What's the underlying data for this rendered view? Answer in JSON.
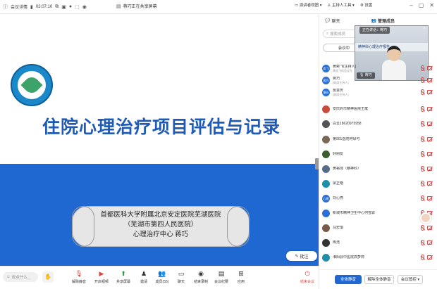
{
  "topbar": {
    "meeting_details": "会议详情",
    "timer": "02:07:10",
    "sharing_status": "蒋巧正在共享屏幕",
    "speaker_view": "演讲者视图",
    "host_tools": "主持人工具",
    "settings": "设置"
  },
  "slide": {
    "title": "住院心理治疗项目评估与记录",
    "caption_line1": "首都医科大学附属北京安定医院芜湖医院",
    "caption_line2": "（芜湖市第四人民医院）",
    "caption_line3": "心理治疗中心    蒋巧",
    "annotate_label": "批注"
  },
  "bottombar": {
    "say_something": "说点什么...",
    "tools": [
      {
        "label": "解除静音",
        "icon": "mic-muted-icon"
      },
      {
        "label": "开启视频",
        "icon": "camera-off-icon"
      },
      {
        "label": "共享屏幕",
        "icon": "share-screen-icon"
      },
      {
        "label": "邀请",
        "icon": "invite-icon"
      },
      {
        "label": "成员(55)",
        "icon": "members-icon"
      },
      {
        "label": "聊天",
        "icon": "chat-icon"
      },
      {
        "label": "结束录制",
        "icon": "record-icon"
      },
      {
        "label": "会议纪要",
        "icon": "minutes-icon"
      },
      {
        "label": "应用",
        "icon": "apps-icon"
      }
    ],
    "end_meeting": "结束会议"
  },
  "panel": {
    "tab_chat": "聊天",
    "tab_manage": "管理成员",
    "search_placeholder": "搜索成员",
    "segment_label": "会议中",
    "video_speaking": "正在讲话：蒋巧",
    "video_banner": "精神科心理治疗报告",
    "video_name": "蒋巧",
    "members": [
      {
        "name": "黄奕飞(主持人)",
        "sub": "黄奕飞的会议号",
        "avatar_text": "奕飞",
        "avatar_color": "#2b6fd6"
      },
      {
        "name": "蒋巧",
        "sub": "(联席主持人)",
        "avatar_text": "蒋巧",
        "avatar_color": "#2b6fd6"
      },
      {
        "name": "詹慧芳",
        "sub": "(联席主持人)",
        "avatar_text": "慧芳",
        "avatar_color": "#2b6fd6"
      },
      {
        "name": "安庆的市精神医院王斌",
        "sub": "",
        "avatar_text": "",
        "avatar_color": "#c94b3c"
      },
      {
        "name": "白云18620975958",
        "sub": "",
        "avatar_text": "",
        "avatar_color": "#555"
      },
      {
        "name": "第901医院何绿可",
        "sub": "",
        "avatar_text": "",
        "avatar_color": "#7a6a55"
      },
      {
        "name": "好朋友",
        "sub": "",
        "avatar_text": "",
        "avatar_color": "#3b5f2f"
      },
      {
        "name": "黄裕佳（精神科）",
        "sub": "",
        "avatar_text": "",
        "avatar_color": "#556b88"
      },
      {
        "name": "梁正艳",
        "sub": "",
        "avatar_text": "",
        "avatar_color": "#1f8ea8"
      },
      {
        "name": "刘心燕",
        "sub": "",
        "avatar_text": "心燕",
        "avatar_color": "#2b6fd6"
      },
      {
        "name": "新城市精神卫生中心何雪霏",
        "sub": "",
        "avatar_text": "",
        "avatar_color": "#2b6fd6"
      },
      {
        "name": "马宏琪",
        "sub": "",
        "avatar_text": "",
        "avatar_color": "#7b5a45"
      },
      {
        "name": "陶浩",
        "sub": "",
        "avatar_text": "",
        "avatar_color": "#333"
      },
      {
        "name": "淮阳县中医院高梦婷",
        "sub": "",
        "avatar_text": "",
        "avatar_color": "#1f8ea8"
      }
    ],
    "btn_mute_all": "全体静音",
    "btn_unmute_all": "解除全体静音",
    "btn_manage": "会议管控"
  }
}
